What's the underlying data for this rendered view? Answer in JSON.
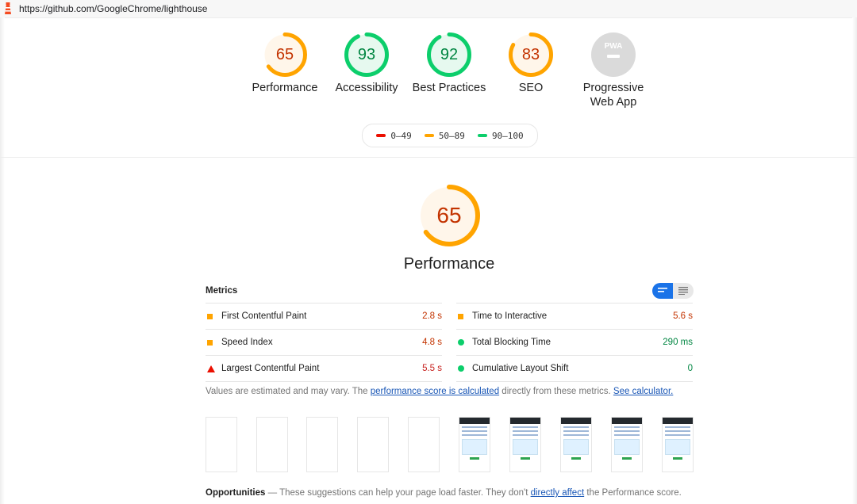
{
  "url": "https://github.com/GoogleChrome/lighthouse",
  "colors": {
    "fail": "#eb0f00",
    "average": "#ffa400",
    "pass": "#0cce6b",
    "gray": "#bdbdbd"
  },
  "gauges": [
    {
      "score": 65,
      "score_text": "65",
      "label": "Performance",
      "status": "average"
    },
    {
      "score": 93,
      "score_text": "93",
      "label": "Accessibility",
      "status": "pass"
    },
    {
      "score": 92,
      "score_text": "92",
      "label": "Best Practices",
      "status": "pass"
    },
    {
      "score": 83,
      "score_text": "83",
      "label": "SEO",
      "status": "average"
    },
    {
      "score": null,
      "score_text": "",
      "label": "Progressive Web App",
      "status": "pwa",
      "badge": "PWA"
    }
  ],
  "legend": [
    {
      "label": "0–49",
      "status": "fail"
    },
    {
      "label": "50–89",
      "status": "average"
    },
    {
      "label": "90–100",
      "status": "pass"
    }
  ],
  "performance": {
    "score": 65,
    "score_text": "65",
    "title": "Performance"
  },
  "metrics": {
    "heading": "Metrics",
    "left": [
      {
        "label": "First Contentful Paint",
        "value": "2.8 s",
        "status": "average"
      },
      {
        "label": "Speed Index",
        "value": "4.8 s",
        "status": "average"
      },
      {
        "label": "Largest Contentful Paint",
        "value": "5.5 s",
        "status": "fail"
      }
    ],
    "right": [
      {
        "label": "Time to Interactive",
        "value": "5.6 s",
        "status": "average"
      },
      {
        "label": "Total Blocking Time",
        "value": "290 ms",
        "status": "pass"
      },
      {
        "label": "Cumulative Layout Shift",
        "value": "0",
        "status": "pass"
      }
    ]
  },
  "note": {
    "before": "Values are estimated and may vary. The ",
    "link1": "performance score is calculated",
    "middle": " directly from these metrics. ",
    "link2": "See calculator."
  },
  "filmstrip": {
    "blank_frames": 5,
    "rendered_frames": 5
  },
  "opportunities": {
    "title": "Opportunities",
    "dash": " — ",
    "text": "These suggestions can help your page load faster. They don't ",
    "link": "directly affect",
    "after": " the Performance score."
  }
}
